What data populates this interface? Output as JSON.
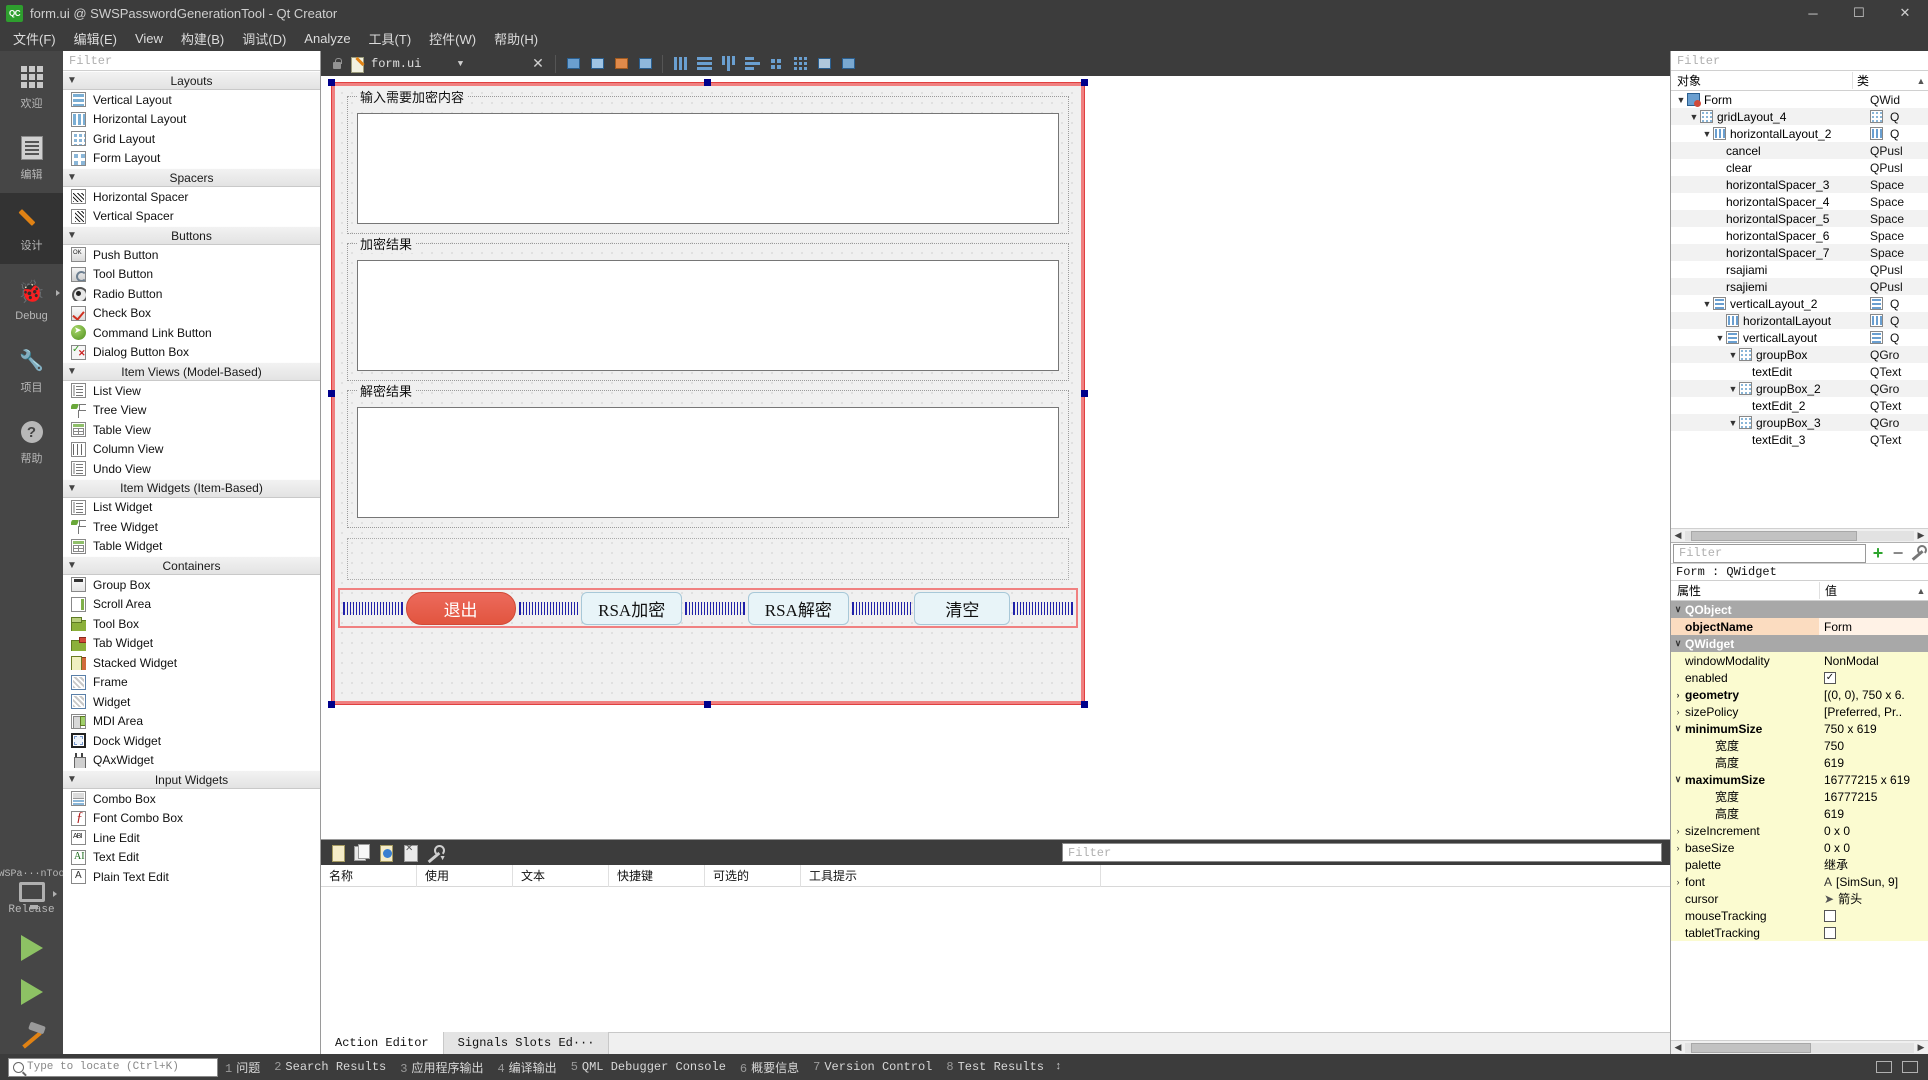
{
  "window": {
    "title": "form.ui @ SWSPasswordGenerationTool - Qt Creator",
    "logo": "QC",
    "minimize": "─",
    "maximize": "☐",
    "close": "✕"
  },
  "menubar": [
    {
      "label": "文件(F)"
    },
    {
      "label": "编辑(E)"
    },
    {
      "label": "View"
    },
    {
      "label": "构建(B)"
    },
    {
      "label": "调试(D)"
    },
    {
      "label": "Analyze"
    },
    {
      "label": "工具(T)"
    },
    {
      "label": "控件(W)"
    },
    {
      "label": "帮助(H)"
    }
  ],
  "modebar": {
    "items": [
      {
        "label": "欢迎",
        "icon": "grid-icon",
        "selected": false,
        "arrow": false
      },
      {
        "label": "编辑",
        "icon": "edit-icon",
        "selected": false,
        "arrow": false
      },
      {
        "label": "设计",
        "icon": "pencil-icon",
        "selected": true,
        "arrow": false
      },
      {
        "label": "Debug",
        "icon": "bug-icon",
        "selected": false,
        "arrow": true
      },
      {
        "label": "项目",
        "icon": "wrench-icon",
        "selected": false,
        "arrow": false
      },
      {
        "label": "帮助",
        "icon": "help-icon",
        "selected": false,
        "arrow": false
      }
    ],
    "kit": {
      "project": "SWSPa···nTool",
      "build": "Release",
      "run_icon": "run-icon",
      "debug_icon": "run-debug-icon",
      "build_icon": "hammer-icon"
    }
  },
  "widgetbox": {
    "filter_placeholder": "Filter",
    "categories": [
      {
        "name": "Layouts",
        "items": [
          {
            "label": "Vertical Layout",
            "icon": "vertical-layout-icon",
            "cls": "i-vlayout"
          },
          {
            "label": "Horizontal Layout",
            "icon": "horizontal-layout-icon",
            "cls": "i-hlayout"
          },
          {
            "label": "Grid Layout",
            "icon": "grid-layout-icon",
            "cls": "i-grid"
          },
          {
            "label": "Form Layout",
            "icon": "form-layout-icon",
            "cls": "i-form"
          }
        ]
      },
      {
        "name": "Spacers",
        "items": [
          {
            "label": "Horizontal Spacer",
            "icon": "horizontal-spacer-icon",
            "cls": "i-hspacer"
          },
          {
            "label": "Vertical Spacer",
            "icon": "vertical-spacer-icon",
            "cls": "i-vspacer"
          }
        ]
      },
      {
        "name": "Buttons",
        "items": [
          {
            "label": "Push Button",
            "icon": "push-button-icon",
            "cls": "i-push"
          },
          {
            "label": "Tool Button",
            "icon": "tool-button-icon",
            "cls": "i-tool"
          },
          {
            "label": "Radio Button",
            "icon": "radio-button-icon",
            "cls": "i-radio"
          },
          {
            "label": "Check Box",
            "icon": "check-box-icon",
            "cls": "i-check"
          },
          {
            "label": "Command Link Button",
            "icon": "command-link-icon",
            "cls": "i-cmdlink"
          },
          {
            "label": "Dialog Button Box",
            "icon": "dialog-button-box-icon",
            "cls": "i-dialogbb"
          }
        ]
      },
      {
        "name": "Item Views (Model-Based)",
        "items": [
          {
            "label": "List View",
            "icon": "list-view-icon",
            "cls": "i-listview"
          },
          {
            "label": "Tree View",
            "icon": "tree-view-icon",
            "cls": "i-treeview"
          },
          {
            "label": "Table View",
            "icon": "table-view-icon",
            "cls": "i-tableview"
          },
          {
            "label": "Column View",
            "icon": "column-view-icon",
            "cls": "i-columnview"
          },
          {
            "label": "Undo View",
            "icon": "undo-view-icon",
            "cls": "i-listview"
          }
        ]
      },
      {
        "name": "Item Widgets (Item-Based)",
        "items": [
          {
            "label": "List Widget",
            "icon": "list-widget-icon",
            "cls": "i-listview"
          },
          {
            "label": "Tree Widget",
            "icon": "tree-widget-icon",
            "cls": "i-treeview"
          },
          {
            "label": "Table Widget",
            "icon": "table-widget-icon",
            "cls": "i-tableview"
          }
        ]
      },
      {
        "name": "Containers",
        "items": [
          {
            "label": "Group Box",
            "icon": "group-box-icon",
            "cls": "i-groupbox"
          },
          {
            "label": "Scroll Area",
            "icon": "scroll-area-icon",
            "cls": "i-scrollarea"
          },
          {
            "label": "Tool Box",
            "icon": "tool-box-icon",
            "cls": "i-toolbox"
          },
          {
            "label": "Tab Widget",
            "icon": "tab-widget-icon",
            "cls": "i-tabwidget"
          },
          {
            "label": "Stacked Widget",
            "icon": "stacked-widget-icon",
            "cls": "i-stacked"
          },
          {
            "label": "Frame",
            "icon": "frame-icon",
            "cls": "i-frame"
          },
          {
            "label": "Widget",
            "icon": "widget-icon",
            "cls": "i-frame"
          },
          {
            "label": "MDI Area",
            "icon": "mdi-area-icon",
            "cls": "i-mdi"
          },
          {
            "label": "Dock Widget",
            "icon": "dock-widget-icon",
            "cls": "i-dockwidget"
          },
          {
            "label": "QAxWidget",
            "icon": "qax-widget-icon",
            "cls": "i-qax"
          }
        ]
      },
      {
        "name": "Input Widgets",
        "items": [
          {
            "label": "Combo Box",
            "icon": "combo-box-icon",
            "cls": "i-combobox"
          },
          {
            "label": "Font Combo Box",
            "icon": "font-combo-box-icon",
            "cls": "i-fontcombo"
          },
          {
            "label": "Line Edit",
            "icon": "line-edit-icon",
            "cls": "i-lineedit"
          },
          {
            "label": "Text Edit",
            "icon": "text-edit-icon",
            "cls": "i-textedit"
          },
          {
            "label": "Plain Text Edit",
            "icon": "plain-text-edit-icon",
            "cls": "i-plain"
          }
        ]
      }
    ]
  },
  "editor": {
    "open_file": "form.ui",
    "close_label": "✕",
    "dropdown_caret": "▼"
  },
  "form": {
    "groupboxes": [
      {
        "title": "输入需要加密内容",
        "name": "groupBox"
      },
      {
        "title": "加密结果",
        "name": "groupBox_2"
      },
      {
        "title": "解密结果",
        "name": "groupBox_3"
      }
    ],
    "buttons": [
      {
        "label": "退出",
        "name": "cancel",
        "style": "danger"
      },
      {
        "label": "RSA加密",
        "name": "rsajiami",
        "style": "normal"
      },
      {
        "label": "RSA解密",
        "name": "rsajiemi",
        "style": "normal"
      },
      {
        "label": "清空",
        "name": "clear",
        "style": "normal"
      }
    ]
  },
  "objecttree": {
    "filter_placeholder": "Filter",
    "col_object": "对象",
    "col_class": "类",
    "rows": [
      {
        "indent": 0,
        "chev": "∨",
        "icon": "t-form",
        "name": "Form",
        "cls": "QWid",
        "clsicon": "",
        "alt": false
      },
      {
        "indent": 1,
        "chev": "∨",
        "icon": "t-grid",
        "name": "gridLayout_4",
        "cls": "Q",
        "clsicon": "t-grid",
        "alt": true
      },
      {
        "indent": 2,
        "chev": "∨",
        "icon": "t-hbox",
        "name": "horizontalLayout_2",
        "cls": "Q",
        "clsicon": "t-hbox",
        "alt": false
      },
      {
        "indent": 3,
        "chev": "",
        "icon": "",
        "name": "cancel",
        "cls": "QPusl",
        "clsicon": "",
        "alt": true
      },
      {
        "indent": 3,
        "chev": "",
        "icon": "",
        "name": "clear",
        "cls": "QPusl",
        "clsicon": "",
        "alt": false
      },
      {
        "indent": 3,
        "chev": "",
        "icon": "",
        "name": "horizontalSpacer_3",
        "cls": "Space",
        "clsicon": "",
        "alt": true
      },
      {
        "indent": 3,
        "chev": "",
        "icon": "",
        "name": "horizontalSpacer_4",
        "cls": "Space",
        "clsicon": "",
        "alt": false
      },
      {
        "indent": 3,
        "chev": "",
        "icon": "",
        "name": "horizontalSpacer_5",
        "cls": "Space",
        "clsicon": "",
        "alt": true
      },
      {
        "indent": 3,
        "chev": "",
        "icon": "",
        "name": "horizontalSpacer_6",
        "cls": "Space",
        "clsicon": "",
        "alt": false
      },
      {
        "indent": 3,
        "chev": "",
        "icon": "",
        "name": "horizontalSpacer_7",
        "cls": "Space",
        "clsicon": "",
        "alt": true
      },
      {
        "indent": 3,
        "chev": "",
        "icon": "",
        "name": "rsajiami",
        "cls": "QPusl",
        "clsicon": "",
        "alt": false
      },
      {
        "indent": 3,
        "chev": "",
        "icon": "",
        "name": "rsajiemi",
        "cls": "QPusl",
        "clsicon": "",
        "alt": true
      },
      {
        "indent": 2,
        "chev": "∨",
        "icon": "t-vbox",
        "name": "verticalLayout_2",
        "cls": "Q",
        "clsicon": "t-vbox",
        "alt": false
      },
      {
        "indent": 3,
        "chev": "",
        "icon": "t-hbox",
        "name": "horizontalLayout",
        "cls": "Q",
        "clsicon": "t-hbox",
        "alt": true
      },
      {
        "indent": 3,
        "chev": "∨",
        "icon": "t-vbox",
        "name": "verticalLayout",
        "cls": "Q",
        "clsicon": "t-vbox",
        "alt": false
      },
      {
        "indent": 4,
        "chev": "∨",
        "icon": "t-grid",
        "name": "groupBox",
        "cls": "QGro",
        "clsicon": "",
        "alt": true
      },
      {
        "indent": 5,
        "chev": "",
        "icon": "",
        "name": "textEdit",
        "cls": "QText",
        "clsicon": "",
        "alt": false
      },
      {
        "indent": 4,
        "chev": "∨",
        "icon": "t-grid",
        "name": "groupBox_2",
        "cls": "QGro",
        "clsicon": "",
        "alt": true
      },
      {
        "indent": 5,
        "chev": "",
        "icon": "",
        "name": "textEdit_2",
        "cls": "QText",
        "clsicon": "",
        "alt": false
      },
      {
        "indent": 4,
        "chev": "∨",
        "icon": "t-grid",
        "name": "groupBox_3",
        "cls": "QGro",
        "clsicon": "",
        "alt": true
      },
      {
        "indent": 5,
        "chev": "",
        "icon": "",
        "name": "textEdit_3",
        "cls": "QText",
        "clsicon": "",
        "alt": false
      }
    ]
  },
  "properties": {
    "filter_placeholder": "Filter",
    "add_label": "+",
    "remove_label": "−",
    "configure_icon": "wrench-icon",
    "object_line": "Form : QWidget",
    "col_property": "属性",
    "col_value": "值",
    "rows": [
      {
        "kind": "group",
        "chev": "∨",
        "key": "QObject",
        "value": ""
      },
      {
        "kind": "orange",
        "chev": "",
        "key": "objectName",
        "value": "Form"
      },
      {
        "kind": "group",
        "chev": "∨",
        "key": "QWidget",
        "value": ""
      },
      {
        "kind": "yellow",
        "chev": "",
        "key": "windowModality",
        "value": "NonModal"
      },
      {
        "kind": "yellow",
        "chev": "",
        "key": "enabled",
        "value": "",
        "checkbox": true,
        "checked": true
      },
      {
        "kind": "yellow bold",
        "chev": "›",
        "key": "geometry",
        "value": "[(0, 0), 750 x 6."
      },
      {
        "kind": "yellow",
        "chev": "›",
        "key": "sizePolicy",
        "value": "[Preferred, Pr.."
      },
      {
        "kind": "yellow bold",
        "chev": "∨",
        "key": "minimumSize",
        "value": "750 x 619"
      },
      {
        "kind": "yellow",
        "chev": "",
        "key": "宽度",
        "value": "750",
        "sub": true
      },
      {
        "kind": "yellow",
        "chev": "",
        "key": "高度",
        "value": "619",
        "sub": true
      },
      {
        "kind": "yellow bold",
        "chev": "∨",
        "key": "maximumSize",
        "value": "16777215 x 619"
      },
      {
        "kind": "yellow",
        "chev": "",
        "key": "宽度",
        "value": "16777215",
        "sub": true
      },
      {
        "kind": "yellow",
        "chev": "",
        "key": "高度",
        "value": "619",
        "sub": true
      },
      {
        "kind": "yellow",
        "chev": "›",
        "key": "sizeIncrement",
        "value": "0 x 0"
      },
      {
        "kind": "yellow",
        "chev": "›",
        "key": "baseSize",
        "value": "0 x 0"
      },
      {
        "kind": "yellow",
        "chev": "",
        "key": "palette",
        "value": "继承"
      },
      {
        "kind": "yellow",
        "chev": "›",
        "key": "font",
        "value": "[SimSun, 9]",
        "prefix": "A"
      },
      {
        "kind": "yellow",
        "chev": "",
        "key": "cursor",
        "value": "箭头",
        "prefix": "➤"
      },
      {
        "kind": "yellow",
        "chev": "",
        "key": "mouseTracking",
        "value": "",
        "checkbox": true,
        "checked": false
      },
      {
        "kind": "yellow",
        "chev": "",
        "key": "tabletTracking",
        "value": "",
        "checkbox": true,
        "checked": false
      }
    ]
  },
  "actioneditor": {
    "filter_placeholder": "Filter",
    "columns": [
      "名称",
      "使用",
      "文本",
      "快捷键",
      "可选的",
      "工具提示"
    ],
    "toolbar": [
      {
        "icon": "new-action-icon",
        "cls": "new"
      },
      {
        "icon": "copy-action-icon",
        "cls": "copy"
      },
      {
        "icon": "edit-action-icon",
        "cls": "edit"
      },
      {
        "icon": "delete-action-icon",
        "cls": "del"
      },
      {
        "icon": "configure-icon",
        "cls": "wrench"
      }
    ],
    "tabs": [
      {
        "label": "Action Editor",
        "selected": true
      },
      {
        "label": "Signals  Slots Ed···",
        "selected": false
      }
    ]
  },
  "statusbar": {
    "locator_placeholder": "Type to locate (Ctrl+K)",
    "search_icon": "search-icon",
    "items": [
      {
        "num": "1",
        "label": "问题"
      },
      {
        "num": "2",
        "label": "Search Results"
      },
      {
        "num": "3",
        "label": "应用程序输出"
      },
      {
        "num": "4",
        "label": "编译输出"
      },
      {
        "num": "5",
        "label": "QML Debugger Console"
      },
      {
        "num": "6",
        "label": "概要信息"
      },
      {
        "num": "7",
        "label": "Version Control"
      },
      {
        "num": "8",
        "label": "Test Results"
      }
    ],
    "updown": "↕"
  },
  "colors": {
    "chrome": "#3c3c3c",
    "selection_red": "#f08080",
    "danger_button": "#e2553f",
    "button_face": "#e8f4f8",
    "property_yellow": "#fbfbd0",
    "property_orange": "#fbdcc0"
  }
}
